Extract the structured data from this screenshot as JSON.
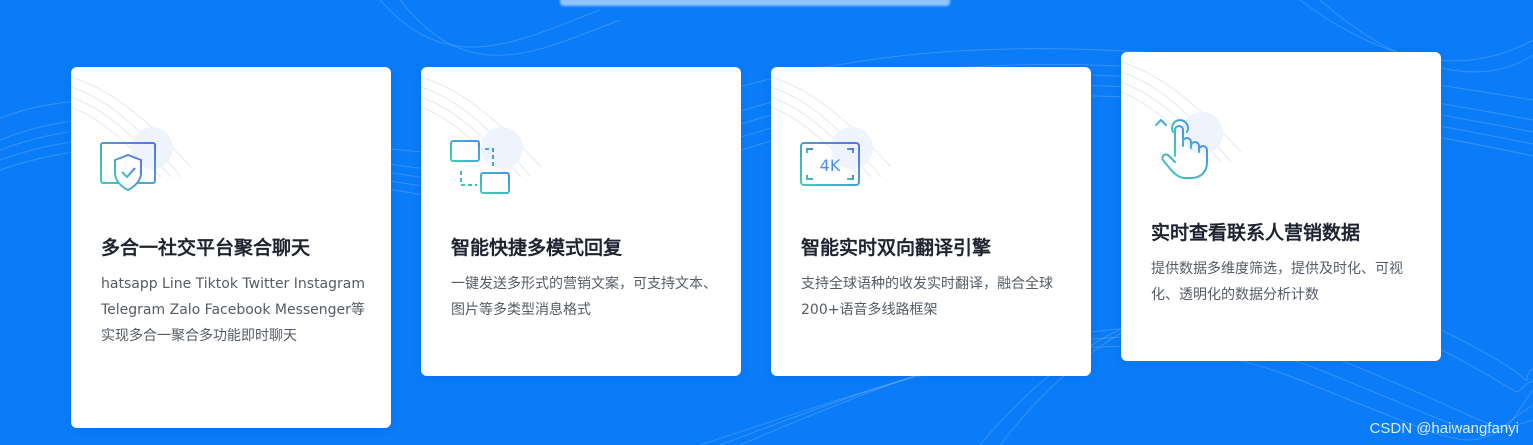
{
  "cards": [
    {
      "icon": "shield-browser-icon",
      "title": "多合一社交平台聚合聊天",
      "description": "hatsapp Line Tiktok Twitter Instagram Telegram Zalo Facebook Messenger等实现多合一聚合多功能即时聊天"
    },
    {
      "icon": "monitor-sync-icon",
      "title": "智能快捷多模式回复",
      "description": "一键发送多形式的营销文案，可支持文本、图片等多类型消息格式"
    },
    {
      "icon": "4k-screen-icon",
      "title": "智能实时双向翻译引擎",
      "description": "支持全球语种的收发实时翻译，融合全球200+语音多线路框架",
      "icon_text": "4K"
    },
    {
      "icon": "hand-touch-icon",
      "title": "实时查看联系人营销数据",
      "description": "提供数据多维度筛选，提供及时化、可视化、透明化的数据分析计数"
    }
  ],
  "watermark": "CSDN @haiwangfanyi",
  "colors": {
    "background": "#0a7cf8",
    "card": "#ffffff",
    "icon_gradient_start": "#3ccfb4",
    "icon_gradient_end": "#4a7ff0"
  }
}
